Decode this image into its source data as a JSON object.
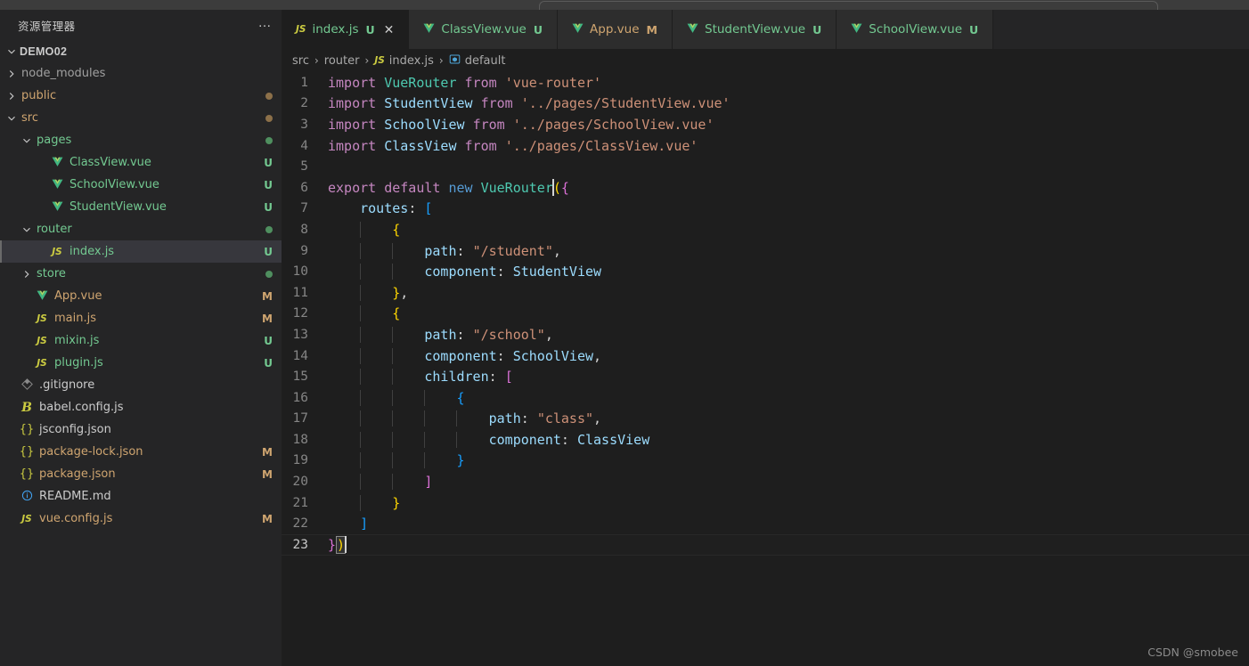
{
  "titlebar": {
    "command_center_placeholder": ""
  },
  "sidebar": {
    "title": "资源管理器",
    "more_actions": "…",
    "root": {
      "label": "DEMO02",
      "expanded": true
    },
    "items": [
      {
        "name": "node_modules",
        "type": "folder",
        "expanded": false,
        "indent": 1,
        "icon": "chevron-right-icon",
        "color": "#a0a0a0",
        "badge": "",
        "badge_color": "",
        "dot": ""
      },
      {
        "name": "public",
        "type": "folder",
        "expanded": false,
        "indent": 1,
        "icon": "chevron-right-icon",
        "color": "#cfa570",
        "badge": "",
        "badge_color": "",
        "dot": "#8c7049"
      },
      {
        "name": "src",
        "type": "folder",
        "expanded": true,
        "indent": 1,
        "icon": "chevron-down-icon",
        "color": "#cfa570",
        "badge": "",
        "badge_color": "",
        "dot": "#8c7049"
      },
      {
        "name": "pages",
        "type": "folder",
        "expanded": true,
        "indent": 2,
        "icon": "chevron-down-icon",
        "color": "#73c991",
        "badge": "",
        "badge_color": "",
        "dot": "#4f8f5f"
      },
      {
        "name": "ClassView.vue",
        "type": "file",
        "expanded": null,
        "indent": 3,
        "icon": "vue-icon",
        "color": "#73c991",
        "badge": "U",
        "badge_color": "#73c991",
        "dot": ""
      },
      {
        "name": "SchoolView.vue",
        "type": "file",
        "expanded": null,
        "indent": 3,
        "icon": "vue-icon",
        "color": "#73c991",
        "badge": "U",
        "badge_color": "#73c991",
        "dot": ""
      },
      {
        "name": "StudentView.vue",
        "type": "file",
        "expanded": null,
        "indent": 3,
        "icon": "vue-icon",
        "color": "#73c991",
        "badge": "U",
        "badge_color": "#73c991",
        "dot": ""
      },
      {
        "name": "router",
        "type": "folder",
        "expanded": true,
        "indent": 2,
        "icon": "chevron-down-icon",
        "color": "#73c991",
        "badge": "",
        "badge_color": "",
        "dot": "#4f8f5f"
      },
      {
        "name": "index.js",
        "type": "file",
        "expanded": null,
        "indent": 3,
        "icon": "js-icon",
        "color": "#73c991",
        "badge": "U",
        "badge_color": "#73c991",
        "dot": "",
        "selected": true
      },
      {
        "name": "store",
        "type": "folder",
        "expanded": false,
        "indent": 2,
        "icon": "chevron-right-icon",
        "color": "#73c991",
        "badge": "",
        "badge_color": "",
        "dot": "#4f8f5f"
      },
      {
        "name": "App.vue",
        "type": "file",
        "expanded": null,
        "indent": 2,
        "icon": "vue-icon",
        "color": "#cfa570",
        "badge": "M",
        "badge_color": "#cfa570",
        "dot": ""
      },
      {
        "name": "main.js",
        "type": "file",
        "expanded": null,
        "indent": 2,
        "icon": "js-icon",
        "color": "#cfa570",
        "badge": "M",
        "badge_color": "#cfa570",
        "dot": ""
      },
      {
        "name": "mixin.js",
        "type": "file",
        "expanded": null,
        "indent": 2,
        "icon": "js-icon",
        "color": "#73c991",
        "badge": "U",
        "badge_color": "#73c991",
        "dot": ""
      },
      {
        "name": "plugin.js",
        "type": "file",
        "expanded": null,
        "indent": 2,
        "icon": "js-icon",
        "color": "#73c991",
        "badge": "U",
        "badge_color": "#73c991",
        "dot": ""
      },
      {
        "name": ".gitignore",
        "type": "file",
        "expanded": null,
        "indent": 1,
        "icon": "git-icon",
        "color": "#cccccc",
        "badge": "",
        "badge_color": "",
        "dot": ""
      },
      {
        "name": "babel.config.js",
        "type": "file",
        "expanded": null,
        "indent": 1,
        "icon": "babel-icon",
        "color": "#cccccc",
        "badge": "",
        "badge_color": "",
        "dot": ""
      },
      {
        "name": "jsconfig.json",
        "type": "file",
        "expanded": null,
        "indent": 1,
        "icon": "json-icon",
        "color": "#cccccc",
        "badge": "",
        "badge_color": "",
        "dot": ""
      },
      {
        "name": "package-lock.json",
        "type": "file",
        "expanded": null,
        "indent": 1,
        "icon": "json-icon",
        "color": "#cfa570",
        "badge": "M",
        "badge_color": "#cfa570",
        "dot": ""
      },
      {
        "name": "package.json",
        "type": "file",
        "expanded": null,
        "indent": 1,
        "icon": "json-icon",
        "color": "#cfa570",
        "badge": "M",
        "badge_color": "#cfa570",
        "dot": ""
      },
      {
        "name": "README.md",
        "type": "file",
        "expanded": null,
        "indent": 1,
        "icon": "info-icon",
        "color": "#cccccc",
        "badge": "",
        "badge_color": "",
        "dot": ""
      },
      {
        "name": "vue.config.js",
        "type": "file",
        "expanded": null,
        "indent": 1,
        "icon": "js-icon",
        "color": "#cfa570",
        "badge": "M",
        "badge_color": "#cfa570",
        "dot": ""
      }
    ]
  },
  "tabs": [
    {
      "label": "index.js",
      "icon": "js-icon",
      "badge": "U",
      "badge_color": "#73c991",
      "label_color": "#73c991",
      "active": true,
      "closable": true,
      "close_glyph": "✕"
    },
    {
      "label": "ClassView.vue",
      "icon": "vue-icon",
      "badge": "U",
      "badge_color": "#73c991",
      "label_color": "#73c991",
      "active": false,
      "closable": false,
      "close_glyph": ""
    },
    {
      "label": "App.vue",
      "icon": "vue-icon",
      "badge": "M",
      "badge_color": "#cfa570",
      "label_color": "#cfa570",
      "active": false,
      "closable": false,
      "close_glyph": ""
    },
    {
      "label": "StudentView.vue",
      "icon": "vue-icon",
      "badge": "U",
      "badge_color": "#73c991",
      "label_color": "#73c991",
      "active": false,
      "closable": false,
      "close_glyph": ""
    },
    {
      "label": "SchoolView.vue",
      "icon": "vue-icon",
      "badge": "U",
      "badge_color": "#73c991",
      "label_color": "#73c991",
      "active": false,
      "closable": false,
      "close_glyph": ""
    }
  ],
  "breadcrumb": {
    "sep": "›",
    "items": [
      {
        "label": "src",
        "icon": ""
      },
      {
        "label": "router",
        "icon": ""
      },
      {
        "label": "index.js",
        "icon": "js-icon"
      },
      {
        "label": "default",
        "icon": "symbol-icon"
      }
    ]
  },
  "code": {
    "language": "javascript",
    "file": "index.js",
    "total_lines": 23,
    "current_line": 23,
    "lines": [
      {
        "n": 1,
        "text": "import VueRouter from 'vue-router'"
      },
      {
        "n": 2,
        "text": "import StudentView from '../pages/StudentView.vue'"
      },
      {
        "n": 3,
        "text": "import SchoolView from '../pages/SchoolView.vue'"
      },
      {
        "n": 4,
        "text": "import ClassView from '../pages/ClassView.vue'"
      },
      {
        "n": 5,
        "text": ""
      },
      {
        "n": 6,
        "text": "export default new VueRouter({"
      },
      {
        "n": 7,
        "text": "    routes: ["
      },
      {
        "n": 8,
        "text": "        {"
      },
      {
        "n": 9,
        "text": "            path: \"/student\","
      },
      {
        "n": 10,
        "text": "            component: StudentView"
      },
      {
        "n": 11,
        "text": "        },"
      },
      {
        "n": 12,
        "text": "        {"
      },
      {
        "n": 13,
        "text": "            path: \"/school\","
      },
      {
        "n": 14,
        "text": "            component: SchoolView,"
      },
      {
        "n": 15,
        "text": "            children: ["
      },
      {
        "n": 16,
        "text": "                {"
      },
      {
        "n": 17,
        "text": "                    path: \"class\","
      },
      {
        "n": 18,
        "text": "                    component: ClassView"
      },
      {
        "n": 19,
        "text": "                }"
      },
      {
        "n": 20,
        "text": "            ]"
      },
      {
        "n": 21,
        "text": "        }"
      },
      {
        "n": 22,
        "text": "    ]"
      },
      {
        "n": 23,
        "text": "})"
      }
    ]
  },
  "watermark": "CSDN @smobee",
  "colors": {
    "editor_bg": "#1e1e1e",
    "sidebar_bg": "#252526",
    "tab_inactive_bg": "#2d2d2d",
    "selection_bg": "#37373d",
    "keyword": "#c586c0",
    "identifier": "#9cdcfe",
    "string": "#ce9178",
    "class": "#4ec9b0",
    "new_keyword": "#569cd6",
    "bracket1": "#ffd700",
    "bracket2": "#da70d6",
    "bracket3": "#179fff",
    "untracked": "#73c991",
    "modified": "#cfa570"
  }
}
